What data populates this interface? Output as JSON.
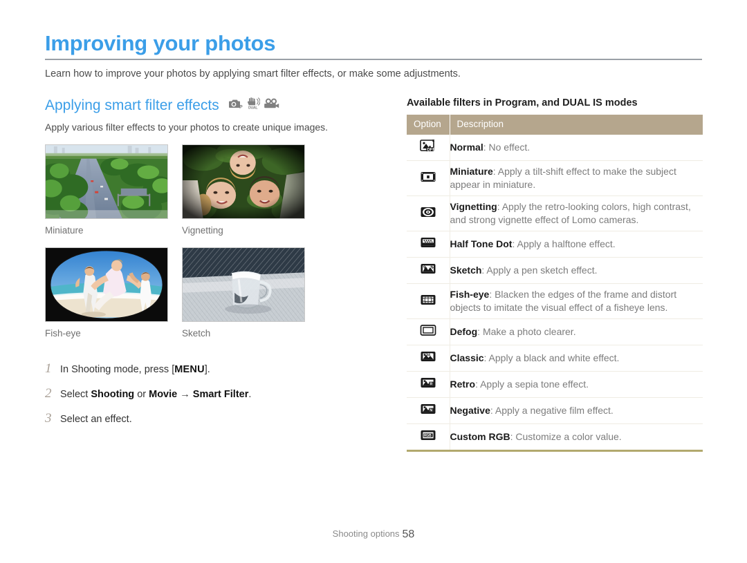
{
  "document": {
    "title": "Improving your photos",
    "intro": "Learn how to improve your photos by applying smart filter effects, or make some adjustments.",
    "title_color": "#3b9ee8"
  },
  "section": {
    "heading": "Applying smart filter effects",
    "subtitle": "Apply various filter effects to your photos to create unique images.",
    "mode_icons": [
      {
        "name": "program-mode-icon",
        "label": "P"
      },
      {
        "name": "dual-is-mode-icon",
        "label": "DUAL"
      },
      {
        "name": "movie-mode-icon",
        "label": "Movie"
      }
    ]
  },
  "samples": [
    {
      "caption": "Miniature",
      "name": "sample-miniature"
    },
    {
      "caption": "Vignetting",
      "name": "sample-vignetting"
    },
    {
      "caption": "Fish-eye",
      "name": "sample-fisheye"
    },
    {
      "caption": "Sketch",
      "name": "sample-sketch"
    }
  ],
  "steps": [
    {
      "num": "1",
      "pre": "In Shooting mode, press [",
      "key": "MENU",
      "post": "]."
    },
    {
      "num": "2",
      "pre": "Select ",
      "bold1": "Shooting",
      "mid1": " or ",
      "bold2": "Movie",
      "arrow": " → ",
      "bold3": "Smart Filter",
      "post": "."
    },
    {
      "num": "3",
      "pre": "Select an effect.",
      "key": "",
      "post": ""
    }
  ],
  "table": {
    "caption": "Available filters in Program, and DUAL IS modes",
    "header": {
      "option": "Option",
      "description": "Description"
    },
    "header_bg": "#b5a68d",
    "bottom_rule_color": "#b2a96e",
    "rows": [
      {
        "icon": "normal-off-icon",
        "name": "Normal",
        "desc": ": No effect."
      },
      {
        "icon": "miniature-icon",
        "name": "Miniature",
        "desc": ": Apply a tilt-shift effect to make the subject appear in miniature."
      },
      {
        "icon": "vignetting-icon",
        "name": "Vignetting",
        "desc": ": Apply the retro-looking colors, high contrast, and strong vignette effect of Lomo cameras."
      },
      {
        "icon": "half-tone-dot-icon",
        "name": "Half Tone Dot",
        "desc": ": Apply a halftone effect."
      },
      {
        "icon": "sketch-icon",
        "name": "Sketch",
        "desc": ": Apply a pen sketch effect."
      },
      {
        "icon": "fish-eye-icon",
        "name": "Fish-eye",
        "desc": ": Blacken the edges of the frame and distort objects to imitate the visual effect of a fisheye lens."
      },
      {
        "icon": "defog-icon",
        "name": "Defog",
        "desc": ": Make a photo clearer."
      },
      {
        "icon": "classic-icon",
        "name": "Classic",
        "desc": ": Apply a black and white effect."
      },
      {
        "icon": "retro-icon",
        "name": "Retro",
        "desc": ": Apply a sepia tone effect."
      },
      {
        "icon": "negative-icon",
        "name": "Negative",
        "desc": ": Apply a negative film effect."
      },
      {
        "icon": "custom-rgb-icon",
        "name": "Custom RGB",
        "desc": ": Customize a color value."
      }
    ]
  },
  "footer": {
    "label": "Shooting options",
    "page": "58"
  }
}
